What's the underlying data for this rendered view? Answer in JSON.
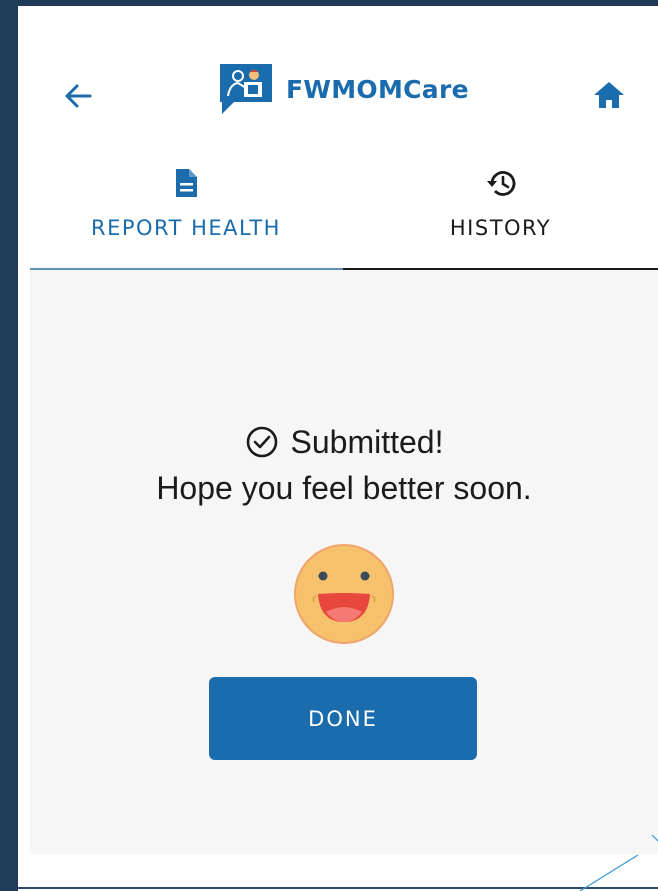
{
  "header": {
    "app_name": "FWMOMCare",
    "back_icon": "arrow-left-icon",
    "home_icon": "home-icon",
    "logo_icon": "fwmomcare-logo-icon"
  },
  "tabs": [
    {
      "label": "REPORT HEALTH",
      "icon": "document-icon",
      "active": true
    },
    {
      "label": "HISTORY",
      "icon": "history-icon",
      "active": false
    }
  ],
  "content": {
    "status": "Submitted!",
    "status_icon": "check-circle-icon",
    "message": "Hope you feel better soon.",
    "emoji_icon": "smiling-face-icon",
    "done_label": "DONE"
  },
  "colors": {
    "accent": "#1a6cad",
    "frame": "#1f3b57",
    "background": "#f6f6f6",
    "text": "#1b1b1b"
  }
}
